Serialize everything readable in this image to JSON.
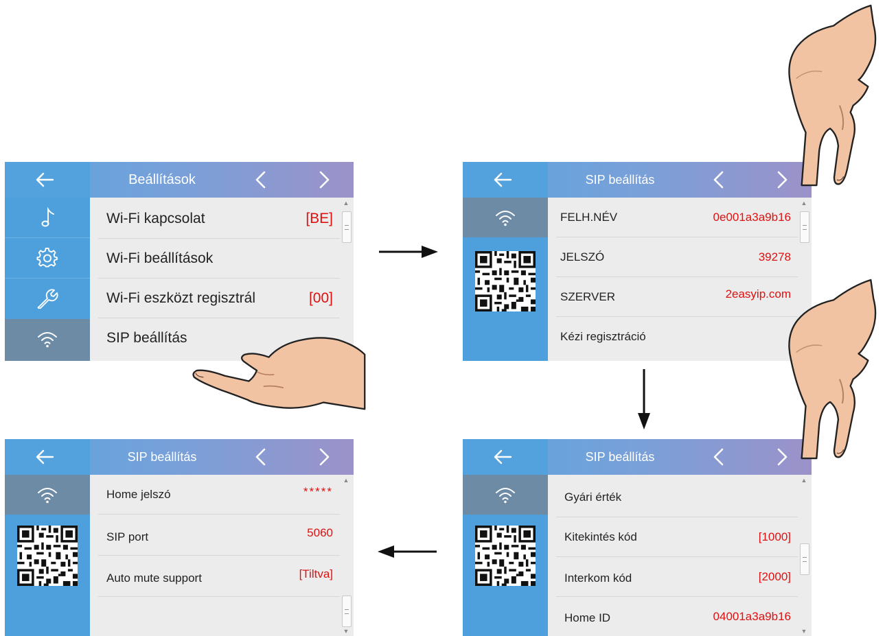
{
  "icons": {
    "back": "back-arrow-icon",
    "prev": "chevron-left-icon",
    "next": "chevron-right-icon",
    "music": "music-note-icon",
    "settings": "gear-icon",
    "tools": "wrench-icon",
    "wifi": "wifi-icon",
    "qr": "qr-code-icon",
    "pointer": "pointing-hand-icon",
    "flow_arrow": "flow-arrow-icon"
  },
  "colors": {
    "header_start": "#5aa6e0",
    "header_end": "#9c92c9",
    "sidebar": "#4da0dc",
    "sidebar_active": "#6e8ba6",
    "value_red": "#e01010"
  },
  "screens": {
    "settings": {
      "title": "Beállítások",
      "rows": [
        {
          "label": "Wi-Fi kapcsolat",
          "value": "[BE]"
        },
        {
          "label": "Wi-Fi beállítások",
          "value": ""
        },
        {
          "label": "Wi-Fi eszközt regisztrál",
          "value": "[00]"
        },
        {
          "label": "SIP beállítás",
          "value": ""
        }
      ]
    },
    "sip_page1": {
      "title": "SIP beállítás",
      "rows": [
        {
          "label": "FELH.NÉV",
          "value": "0e001a3a9b16"
        },
        {
          "label": "JELSZÓ",
          "value": "39278"
        },
        {
          "label": "SZERVER",
          "value": "2easyip.com"
        },
        {
          "label": "Kézi regisztráció",
          "value": ""
        }
      ]
    },
    "sip_page2": {
      "title": "SIP beállítás",
      "rows": [
        {
          "label": "Gyári érték",
          "value": ""
        },
        {
          "label": "Kitekintés kód",
          "value": "[1000]"
        },
        {
          "label": "Interkom kód",
          "value": "[2000]"
        },
        {
          "label": "Home ID",
          "value": "04001a3a9b16"
        }
      ]
    },
    "sip_page3": {
      "title": "SIP beállítás",
      "rows": [
        {
          "label": "Home jelszó",
          "value": "*****"
        },
        {
          "label": "SIP port",
          "value": "5060"
        },
        {
          "label": "Auto mute support",
          "value": "[Tiltva]"
        }
      ]
    }
  }
}
